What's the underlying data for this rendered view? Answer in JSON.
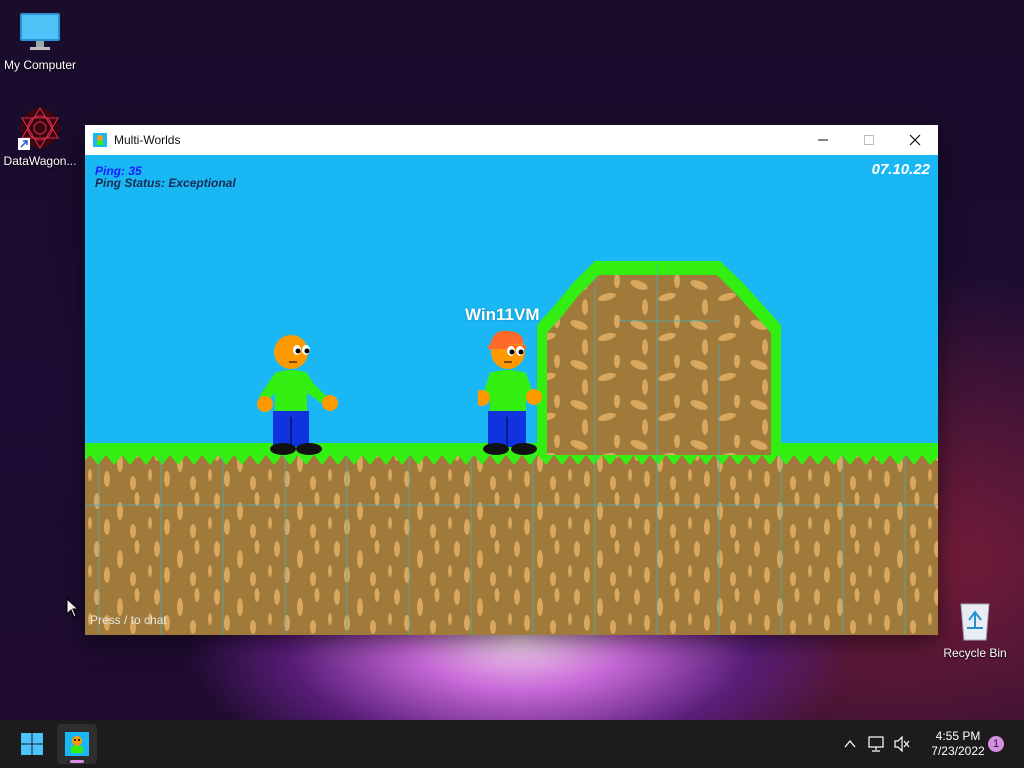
{
  "desktop": {
    "icons": [
      {
        "label": "My Computer"
      },
      {
        "label": "DataWagon..."
      },
      {
        "label": "Recycle Bin"
      }
    ]
  },
  "window": {
    "title": "Multi-Worlds"
  },
  "game": {
    "ping": "Ping: 35",
    "ping_status": "Ping Status: Exceptional",
    "date": "07.10.22",
    "player_name": "Win11VM",
    "chat_hint": "Press / to chat",
    "colors": {
      "sky": "#19b8f4",
      "grass": "#33ee11",
      "dirt": "#a07a3a",
      "ping_text": "#1a1aff"
    }
  },
  "taskbar": {
    "time": "4:55 PM",
    "date": "7/23/2022",
    "notification_count": "1"
  }
}
